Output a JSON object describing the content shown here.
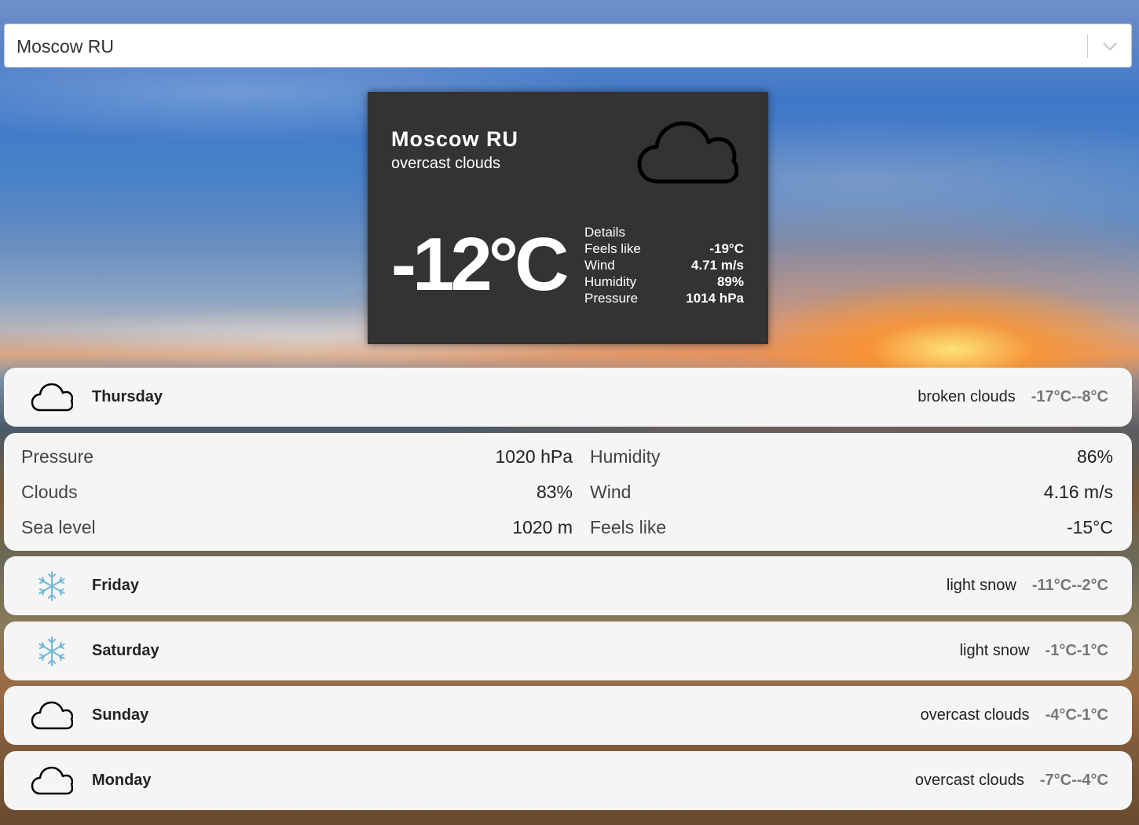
{
  "search": {
    "value": "Moscow RU"
  },
  "current": {
    "city": "Moscow RU",
    "description": "overcast clouds",
    "icon": "cloud-icon",
    "temperature": "-12°C",
    "details_title": "Details",
    "details": [
      {
        "label": "Feels like",
        "value": "-19°C"
      },
      {
        "label": "Wind",
        "value": "4.71 m/s"
      },
      {
        "label": "Humidity",
        "value": "89%"
      },
      {
        "label": "Pressure",
        "value": "1014 hPa"
      }
    ]
  },
  "forecast": [
    {
      "day": "Thursday",
      "icon": "cloud-icon",
      "description": "broken clouds",
      "range": "-17°C--8°C",
      "expanded": true
    },
    {
      "day": "Friday",
      "icon": "snowflake-icon",
      "description": "light snow",
      "range": "-11°C--2°C"
    },
    {
      "day": "Saturday",
      "icon": "snowflake-icon",
      "description": "light snow",
      "range": "-1°C-1°C"
    },
    {
      "day": "Sunday",
      "icon": "cloud-icon",
      "description": "overcast clouds",
      "range": "-4°C-1°C"
    },
    {
      "day": "Monday",
      "icon": "cloud-icon",
      "description": "overcast clouds",
      "range": "-7°C--4°C"
    }
  ],
  "expanded_detail": {
    "left": [
      {
        "label": "Pressure",
        "value": "1020 hPa"
      },
      {
        "label": "Clouds",
        "value": "83%"
      },
      {
        "label": "Sea level",
        "value": "1020 m"
      }
    ],
    "right": [
      {
        "label": "Humidity",
        "value": "86%"
      },
      {
        "label": "Wind",
        "value": "4.16 m/s"
      },
      {
        "label": "Feels like",
        "value": "-15°C"
      }
    ]
  },
  "colors": {
    "card_bg": "#333333",
    "row_bg": "#f5f5f5",
    "snowflake": "#6fb8d8"
  }
}
